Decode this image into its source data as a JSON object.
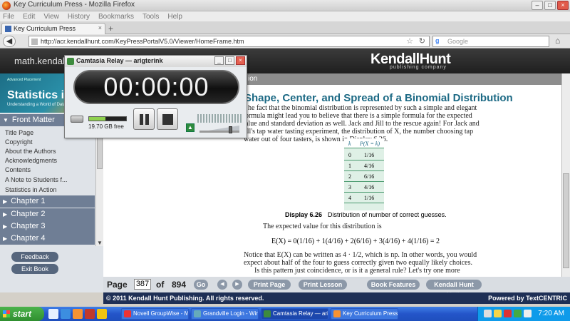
{
  "browser": {
    "window_title": "Key Curriculum Press - Mozilla Firefox",
    "menu": [
      "File",
      "Edit",
      "View",
      "History",
      "Bookmarks",
      "Tools",
      "Help"
    ],
    "tab_label": "Key Curriculum Press",
    "new_tab": "+",
    "url": "http://acr.kendallhunt.com/KeyPressPortalV5.0/Viewer/HomeFrame.htm",
    "search_placeholder": "Google",
    "search_engine_letter": "g"
  },
  "banner": {
    "site_name": "math.kendallhunt.com",
    "logo": "KendallHunt",
    "logo_sub": "publishing company"
  },
  "sidebar": {
    "cover_small": "Advanced Placement",
    "cover_title": "Statistics in Action",
    "cover_sub": "Understanding a World of Data",
    "front_matter": "Front Matter",
    "toc": [
      "Title Page",
      "Copyright",
      "About the Authors",
      "Acknowledgments",
      "Contents",
      "A Note to Students f...",
      "Statistics in Action"
    ],
    "chapters": [
      "Chapter 1",
      "Chapter 2",
      "Chapter 3",
      "Chapter 4"
    ],
    "feedback": "Feedback",
    "exit": "Exit Book"
  },
  "content": {
    "header": "ion",
    "section_title": "Shape, Center, and Spread of a Binomial Distribution",
    "para1": [
      "he fact that the binomial distribution is represented by such a simple and elegant",
      "ormula might lead you to believe that there is a simple formula for the expected",
      "alue and standard deviation as well. Jack and Jill to the rescue again! For Jack and",
      "ill's tap water tasting experiment, the distribution of X, the number choosing tap",
      "water out of four tasters, is shown in Display 6.26."
    ],
    "table": {
      "headers": [
        "k",
        "P(X = k)"
      ],
      "rows": [
        [
          "0",
          "1/16"
        ],
        [
          "1",
          "4/16"
        ],
        [
          "2",
          "6/16"
        ],
        [
          "3",
          "4/16"
        ],
        [
          "4",
          "1/16"
        ]
      ]
    },
    "caption_label": "Display 6.26",
    "caption_text": "Distribution of number of correct guesses.",
    "expected_intro": "The expected value for this distribution is",
    "equation": "E(X) = 0(1/16) + 1(4/16) + 2(6/16) + 3(4/16) + 4(1/16) = 2",
    "para2": [
      "Notice that E(X) can be written as 4 · 1/2, which is np. In other words, you would",
      "expect about half of the four to guess correctly given two equally likely choices.",
      "Is this pattern just coincidence, or is it a general rule? Let's try one more"
    ]
  },
  "pagebar": {
    "page_label": "Page",
    "page_value": "387",
    "of_label": "of",
    "total_pages": "894",
    "go": "Go",
    "print_page": "Print Page",
    "print_lesson": "Print Lesson",
    "book_features": "Book Features",
    "kendall_math": "Kendall Hunt Math"
  },
  "footer": {
    "copyright": "© 2011 Kendall Hunt Publishing. All rights reserved.",
    "powered": "Powered by TextCENTRIC"
  },
  "camtasia": {
    "title": "Camtasia Relay — arigterink",
    "timer": "00:00:00",
    "disk_free": "19.70 GB free",
    "disk_used_fraction": 0.45
  },
  "taskbar": {
    "start": "start",
    "tasks": [
      "Novell GroupWise - M...",
      "Grandville Login - Win...",
      "Camtasia Relay — ari...",
      "Key Curriculum Press ..."
    ],
    "active_task_index": 2,
    "clock": "7:20 AM"
  }
}
